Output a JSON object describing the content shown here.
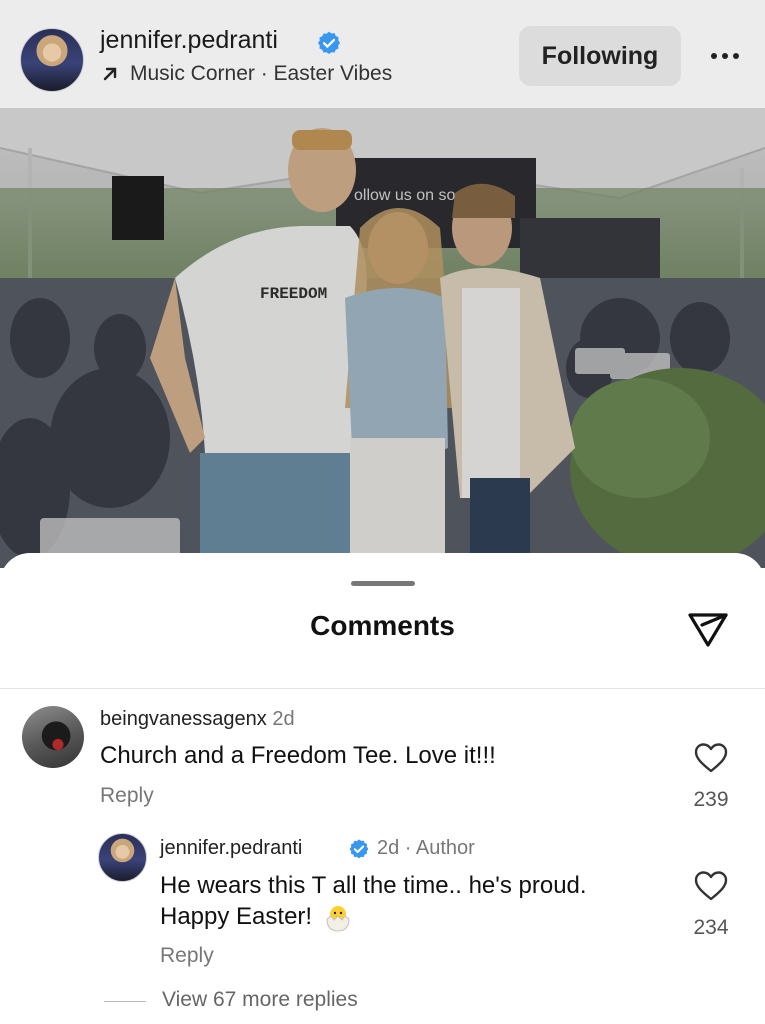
{
  "header": {
    "username": "jennifer.pedranti",
    "subtitle": "Music Corner · Easter Vibes",
    "following_label": "Following",
    "more_icon": "more-horizontal-icon"
  },
  "photo": {
    "shirt_text": "FREEDOM",
    "sign_text": "ollow us on soc"
  },
  "comments_sheet": {
    "title": "Comments",
    "share_icon": "send-icon",
    "comments": [
      {
        "username": "beingvanessagenx",
        "time": "2d",
        "text": "Church and a Freedom Tee. Love it!!!",
        "reply_label": "Reply",
        "likes": "239"
      }
    ],
    "reply": {
      "username": "jennifer.pedranti",
      "meta": "2d · Author",
      "text_line1": "He wears this T all the time.. he's proud.",
      "text_line2": "Happy Easter!",
      "reply_label": "Reply",
      "likes": "234"
    },
    "view_more": "View 67 more replies"
  },
  "colors": {
    "verified": "#3897f0",
    "following_bg": "#dcdcdc"
  }
}
